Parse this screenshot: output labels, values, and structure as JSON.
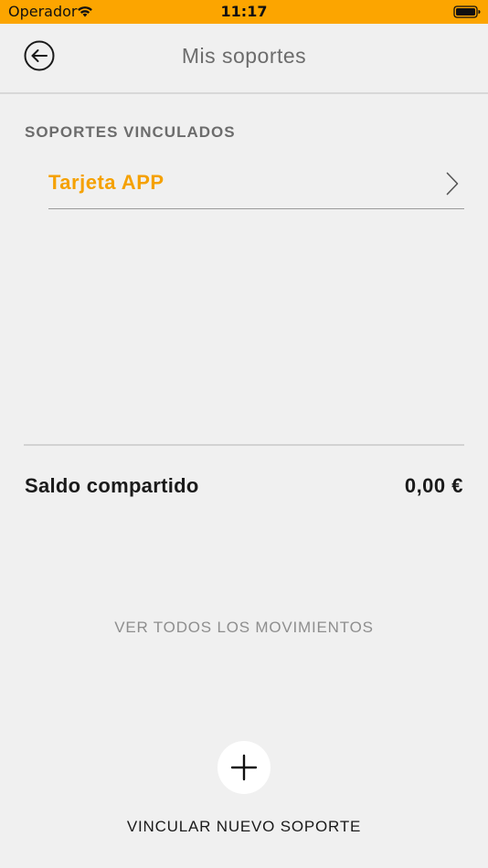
{
  "status_bar": {
    "carrier": "Operador",
    "time": "11:17",
    "wifi_icon": "wifi-icon",
    "battery_icon": "battery-full-icon"
  },
  "header": {
    "back_icon": "arrow-left-circle-icon",
    "title": "Mis soportes"
  },
  "supports_section": {
    "heading": "SOPORTES VINCULADOS",
    "items": [
      {
        "label": "Tarjeta APP",
        "icon": "chevron-right-icon"
      }
    ]
  },
  "balance": {
    "label": "Saldo compartido",
    "value": "0,00 €"
  },
  "movements_link": "VER TODOS LOS MOVIMIENTOS",
  "add_support": {
    "icon": "plus-icon",
    "label": "VINCULAR NUEVO SOPORTE"
  },
  "colors": {
    "status_bar_bg": "#fca500",
    "accent": "#f5a100",
    "background": "#f0f0f0",
    "secondary_text": "#6c6c6c",
    "primary_text": "#1a1a1a"
  }
}
